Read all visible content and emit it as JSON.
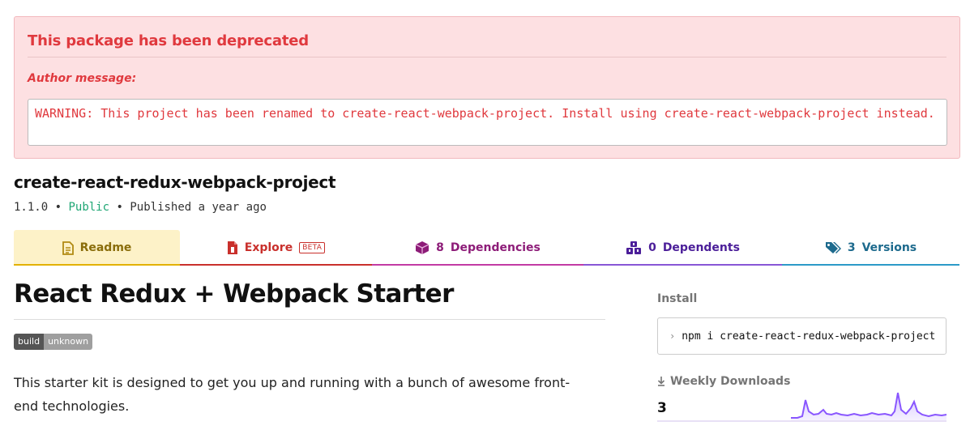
{
  "deprecation": {
    "title": "This package has been deprecated",
    "author_label": "Author message:",
    "message": "WARNING: This project has been renamed to create-react-webpack-project. Install using create-react-webpack-project instead."
  },
  "package": {
    "name": "create-react-redux-webpack-project",
    "version": "1.1.0",
    "separator": "•",
    "visibility": "Public",
    "published": "Published a year ago"
  },
  "tabs": [
    {
      "label": "Readme",
      "icon": "document-icon",
      "count": ""
    },
    {
      "label": "Explore",
      "icon": "file-code-icon",
      "count": "",
      "badge": "BETA"
    },
    {
      "label": "Dependencies",
      "icon": "box-icon",
      "count": "8"
    },
    {
      "label": "Dependents",
      "icon": "boxes-icon",
      "count": "0"
    },
    {
      "label": "Versions",
      "icon": "tags-icon",
      "count": "3"
    }
  ],
  "readme": {
    "title": "React Redux + Webpack Starter",
    "badge_left": "build",
    "badge_right": "unknown",
    "intro": "This starter kit is designed to get you up and running with a bunch of awesome front-end technologies."
  },
  "sidebar": {
    "install_label": "Install",
    "install_command": "npm i create-react-redux-webpack-project",
    "prompt_icon": "chevron-right-icon",
    "downloads_label": "Weekly Downloads",
    "downloads_icon": "download-icon",
    "downloads_value": "3",
    "sparkline_color": "#8956ff"
  },
  "colors": {
    "deprecated_bg": "#fde0e2",
    "deprecated_text": "#e0393e",
    "public": "#1ea674"
  }
}
